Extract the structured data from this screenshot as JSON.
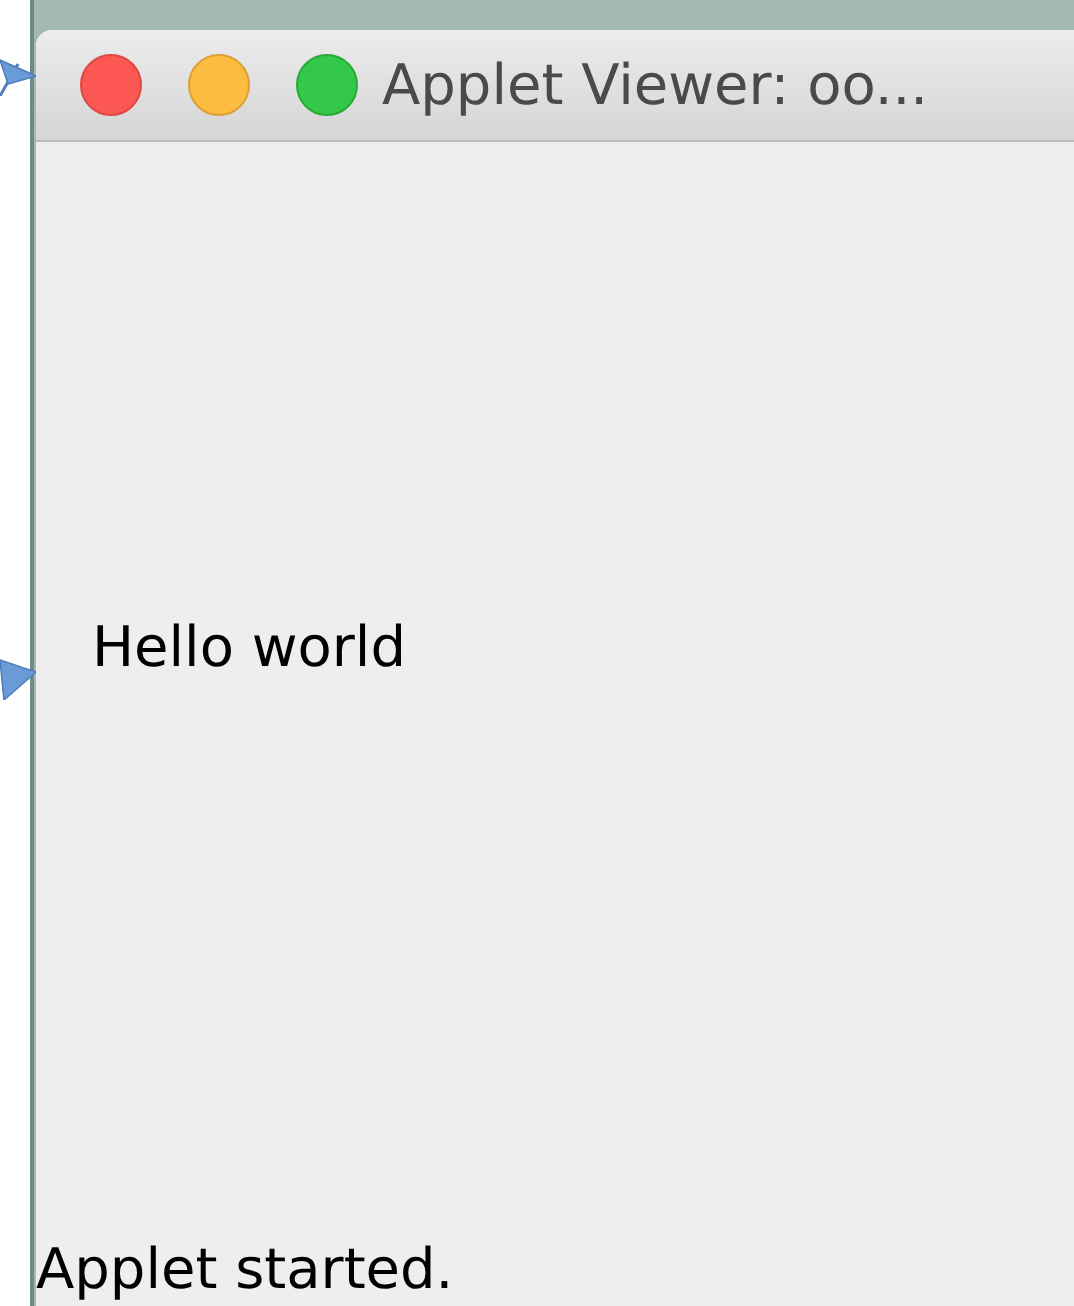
{
  "window": {
    "title": "Applet Viewer: oo..."
  },
  "applet": {
    "text": "Hello world"
  },
  "status_bar": {
    "text": "Applet started."
  }
}
